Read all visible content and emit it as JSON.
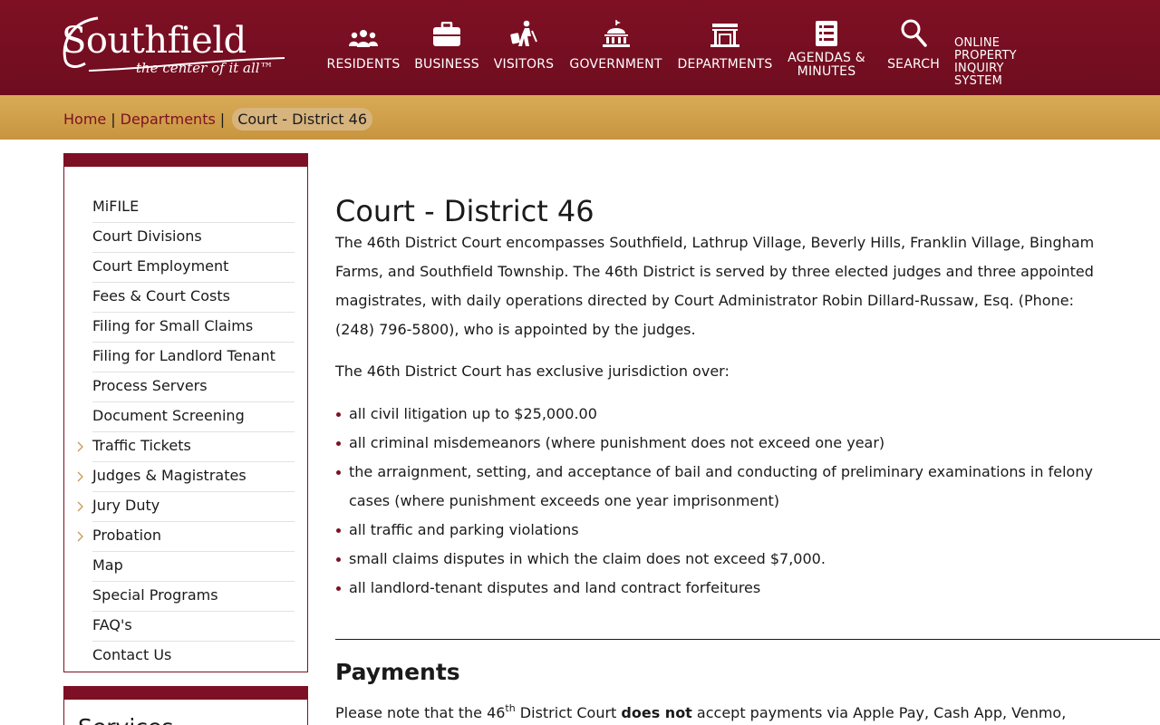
{
  "header": {
    "logo_text": "Southfield",
    "logo_tagline": "the center of it all™",
    "nav": [
      {
        "label": "RESIDENTS",
        "icon": "people-icon"
      },
      {
        "label": "BUSINESS",
        "icon": "briefcase-icon"
      },
      {
        "label": "VISITORS",
        "icon": "traveler-icon"
      },
      {
        "label": "GOVERNMENT",
        "icon": "capitol-building-icon"
      },
      {
        "label": "DEPARTMENTS",
        "icon": "building-icon"
      },
      {
        "label_line1": "AGENDAS &",
        "label_line2": "MINUTES",
        "icon": "document-list-icon"
      },
      {
        "label": "SEARCH",
        "icon": "search-icon"
      }
    ],
    "online_line1": "ONLINE PROPERTY",
    "online_line2": "INQUIRY SYSTEM"
  },
  "breadcrumb": {
    "home": "Home",
    "separator": "|",
    "departments": "Departments",
    "current": "Court - District 46"
  },
  "sidebar": {
    "items": [
      {
        "label": "MiFILE",
        "expandable": false
      },
      {
        "label": "Court Divisions",
        "expandable": false
      },
      {
        "label": "Court Employment",
        "expandable": false
      },
      {
        "label": "Fees & Court Costs",
        "expandable": false
      },
      {
        "label": "Filing for Small Claims",
        "expandable": false
      },
      {
        "label": "Filing for Landlord Tenant",
        "expandable": false
      },
      {
        "label": "Process Servers",
        "expandable": false
      },
      {
        "label": "Document Screening",
        "expandable": false
      },
      {
        "label": "Traffic Tickets",
        "expandable": true
      },
      {
        "label": "Judges & Magistrates",
        "expandable": true
      },
      {
        "label": "Jury Duty",
        "expandable": true
      },
      {
        "label": "Probation",
        "expandable": true
      },
      {
        "label": "Map",
        "expandable": false
      },
      {
        "label": "Special Programs",
        "expandable": false
      },
      {
        "label": "FAQ's",
        "expandable": false
      },
      {
        "label": "Contact Us",
        "expandable": false
      }
    ],
    "services_title": "Services"
  },
  "main": {
    "title": "Court - District 46",
    "intro": "The 46th District Court encompasses Southfield, Lathrup Village, Beverly Hills, Franklin Village, Bingham Farms, and Southfield Township. The 46th District is served by three elected judges and three appointed magistrates, with daily operations directed by Court Administrator Robin Dillard-Russaw, Esq. (Phone: (248) 796-5800), who is appointed by the judges.",
    "jurisdiction_intro": "The 46th District Court has exclusive jurisdiction over:",
    "bullets": [
      "all civil litigation up to $25,000.00",
      "all criminal misdemeanors (where punishment does not exceed one year)",
      "the arraignment, setting, and acceptance of bail and conducting of preliminary examinations in felony cases (where punishment exceeds one year imprisonment)",
      "all traffic and parking violations",
      "small claims disputes in which the claim does not exceed $7,000.",
      "all landlord-tenant disputes and land contract forfeitures"
    ],
    "payments_title": "Payments",
    "payments_prefix": "Please note that the 46",
    "payments_sup": "th",
    "payments_mid": " District Court ",
    "payments_bold": "does not",
    "payments_suffix": " accept payments via Apple Pay, Cash App, Venmo,"
  },
  "colors": {
    "header_maroon": "#7f1024",
    "breadcrumb_gold": "#d0a04a",
    "accent": "#7d1024"
  }
}
